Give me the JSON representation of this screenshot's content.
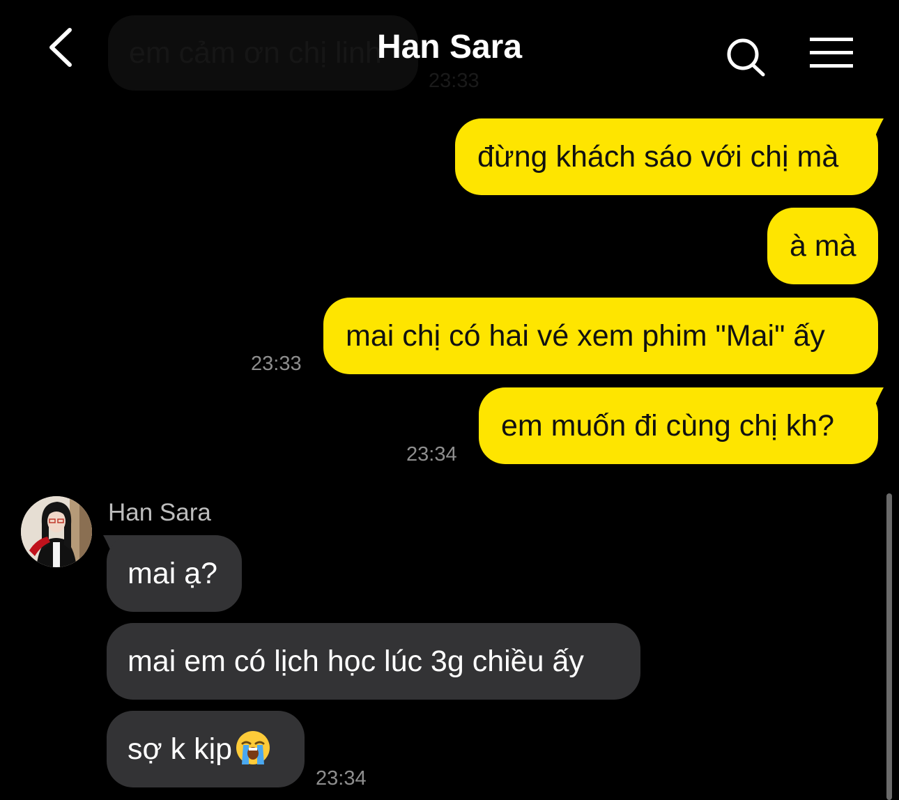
{
  "header": {
    "title": "Han Sara",
    "back_icon": "chevron-left-icon",
    "search_icon": "search-icon",
    "menu_icon": "hamburger-menu-icon"
  },
  "previous_message": {
    "text": "em cảm ơn chị linh",
    "time": "23:33"
  },
  "outgoing": [
    {
      "text": "đừng khách sáo với chị mà"
    },
    {
      "text": "à mà"
    },
    {
      "text": "mai chị có hai vé xem phim \"Mai\" ấy",
      "time": "23:33"
    },
    {
      "text": "em muốn đi cùng chị kh?",
      "time": "23:34"
    }
  ],
  "incoming": {
    "sender": "Han Sara",
    "messages": [
      {
        "text": "mai ạ?"
      },
      {
        "text": "mai em có lịch học lúc 3g chiều ấy"
      },
      {
        "text": "sợ k kịp",
        "emoji": "loudly-crying-face-emoji",
        "time": "23:34"
      }
    ]
  },
  "colors": {
    "background": "#000000",
    "outgoing_bubble": "#fee500",
    "incoming_bubble": "#333335",
    "timestamp": "#8e8e8e"
  }
}
